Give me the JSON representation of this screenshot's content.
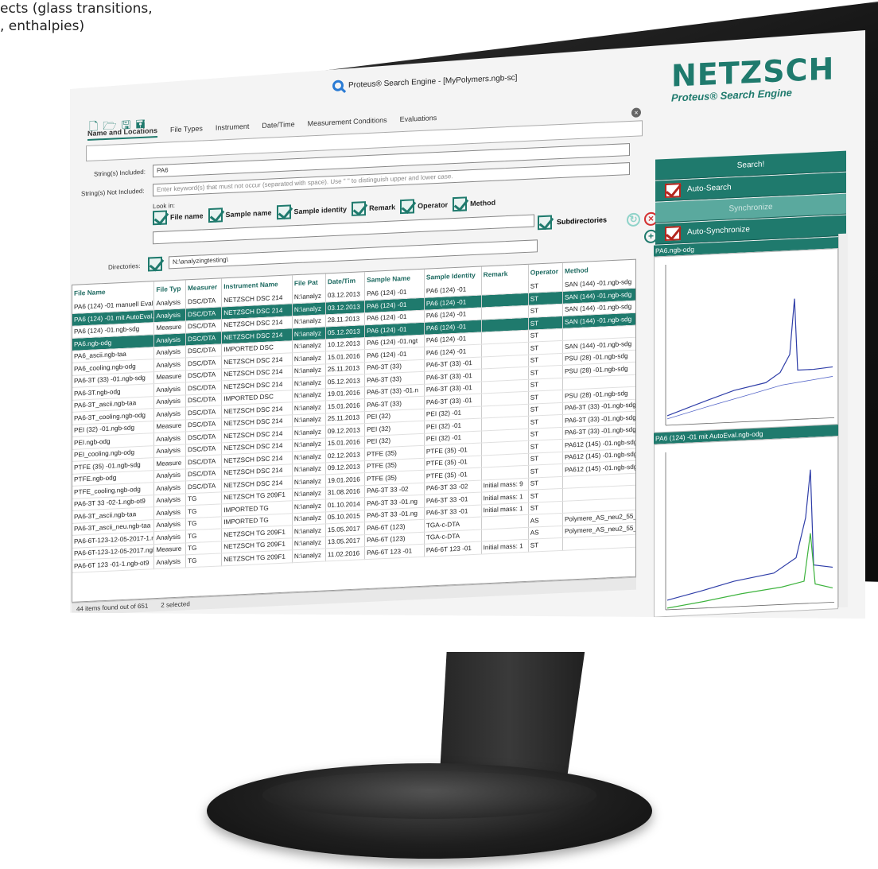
{
  "caption": {
    "line1": "ects (glass transitions,",
    "line2": ", enthalpies)"
  },
  "window": {
    "title": "Proteus® Search Engine - [MyPolymers.ngb-sc]",
    "minimize": "–",
    "maximize": "□",
    "close": "✕"
  },
  "tabs": [
    "Name and Locations",
    "File Types",
    "Instrument",
    "Date/Time",
    "Measurement Conditions",
    "Evaluations"
  ],
  "form": {
    "included_label": "String(s) Included:",
    "included_value": "PA6",
    "not_included_label": "String(s) Not Included:",
    "not_included_placeholder": "Enter keyword(s) that must not occur (separated with space). Use \" \" to distinguish upper and lower case.",
    "look_in_label": "Look in:",
    "look_in": [
      "File name",
      "Sample name",
      "Sample identity",
      "Remark",
      "Operator",
      "Method"
    ],
    "subdirectories_label": "Subdirectories",
    "directories_label": "Directories:",
    "directories_value": "N:\\analyzingtesting\\"
  },
  "table": {
    "columns": [
      "File Name",
      "File Typ",
      "Measurer",
      "Instrument Name",
      "File Pat",
      "Date/Tim",
      "Sample Name",
      "Sample Identity",
      "Remark",
      "Operator",
      "Method"
    ],
    "rows": [
      {
        "cells": [
          "PA6 (124) -01 manuell Eval.n",
          "Analysis",
          "DSC/DTA",
          "NETZSCH DSC 214",
          "N:\\analyz",
          "03.12.2013",
          "PA6 (124) -01",
          "PA6 (124) -01",
          "",
          "ST",
          "SAN (144) -01.ngb-sdg"
        ],
        "state": ""
      },
      {
        "cells": [
          "PA6 (124) -01 mit AutoEval.n",
          "Analysis",
          "DSC/DTA",
          "NETZSCH DSC 214",
          "N:\\analyz",
          "03.12.2013",
          "PA6 (124) -01",
          "PA6 (124) -01",
          "",
          "ST",
          "SAN (144) -01.ngb-sdg"
        ],
        "state": "sel"
      },
      {
        "cells": [
          "PA6 (124) -01.ngb-sdg",
          "Measure",
          "DSC/DTA",
          "NETZSCH DSC 214",
          "N:\\analyz",
          "28.11.2013",
          "PA6 (124) -01",
          "PA6 (124) -01",
          "",
          "ST",
          "SAN (144) -01.ngb-sdg"
        ],
        "state": ""
      },
      {
        "cells": [
          "PA6.ngb-odg",
          "Analysis",
          "DSC/DTA",
          "NETZSCH DSC 214",
          "N:\\analyz",
          "05.12.2013",
          "PA6 (124) -01",
          "PA6 (124) -01",
          "",
          "ST",
          "SAN (144) -01.ngb-sdg"
        ],
        "state": "sel"
      },
      {
        "cells": [
          "PA6_ascii.ngb-taa",
          "Analysis",
          "DSC/DTA",
          "IMPORTED DSC",
          "N:\\analyz",
          "10.12.2013",
          "PA6 (124) -01.ngt",
          "PA6 (124) -01",
          "",
          "ST",
          ""
        ],
        "state": ""
      },
      {
        "cells": [
          "PA6_cooling.ngb-odg",
          "Analysis",
          "DSC/DTA",
          "NETZSCH DSC 214",
          "N:\\analyz",
          "15.01.2016",
          "PA6 (124) -01",
          "PA6 (124) -01",
          "",
          "ST",
          "SAN (144) -01.ngb-sdg"
        ],
        "state": ""
      },
      {
        "cells": [
          "PA6-3T (33) -01.ngb-sdg",
          "Measure",
          "DSC/DTA",
          "NETZSCH DSC 214",
          "N:\\analyz",
          "25.11.2013",
          "PA6-3T (33)",
          "PA6-3T (33) -01",
          "",
          "ST",
          "PSU (28) -01.ngb-sdg"
        ],
        "state": ""
      },
      {
        "cells": [
          "PA6-3T.ngb-odg",
          "Analysis",
          "DSC/DTA",
          "NETZSCH DSC 214",
          "N:\\analyz",
          "05.12.2013",
          "PA6-3T (33)",
          "PA6-3T (33) -01",
          "",
          "ST",
          "PSU (28) -01.ngb-sdg"
        ],
        "state": ""
      },
      {
        "cells": [
          "PA6-3T_ascii.ngb-taa",
          "Analysis",
          "DSC/DTA",
          "IMPORTED DSC",
          "N:\\analyz",
          "19.01.2016",
          "PA6-3T (33) -01.n",
          "PA6-3T (33) -01",
          "",
          "ST",
          ""
        ],
        "state": ""
      },
      {
        "cells": [
          "PA6-3T_cooling.ngb-odg",
          "Analysis",
          "DSC/DTA",
          "NETZSCH DSC 214",
          "N:\\analyz",
          "15.01.2016",
          "PA6-3T (33)",
          "PA6-3T (33) -01",
          "",
          "ST",
          "PSU (28) -01.ngb-sdg"
        ],
        "state": ""
      },
      {
        "cells": [
          "PEI (32) -01.ngb-sdg",
          "Measure",
          "DSC/DTA",
          "NETZSCH DSC 214",
          "N:\\analyz",
          "25.11.2013",
          "PEI (32)",
          "PEI (32) -01",
          "",
          "ST",
          "PA6-3T (33) -01.ngb-sdg"
        ],
        "state": ""
      },
      {
        "cells": [
          "PEI.ngb-odg",
          "Analysis",
          "DSC/DTA",
          "NETZSCH DSC 214",
          "N:\\analyz",
          "09.12.2013",
          "PEI (32)",
          "PEI (32) -01",
          "",
          "ST",
          "PA6-3T (33) -01.ngb-sdg"
        ],
        "state": ""
      },
      {
        "cells": [
          "PEI_cooling.ngb-odg",
          "Analysis",
          "DSC/DTA",
          "NETZSCH DSC 214",
          "N:\\analyz",
          "15.01.2016",
          "PEI (32)",
          "PEI (32) -01",
          "",
          "ST",
          "PA6-3T (33) -01.ngb-sdg"
        ],
        "state": ""
      },
      {
        "cells": [
          "PTFE (35) -01.ngb-sdg",
          "Measure",
          "DSC/DTA",
          "NETZSCH DSC 214",
          "N:\\analyz",
          "02.12.2013",
          "PTFE (35)",
          "PTFE (35) -01",
          "",
          "ST",
          "PA612 (145) -01.ngb-sdg"
        ],
        "state": ""
      },
      {
        "cells": [
          "PTFE.ngb-odg",
          "Analysis",
          "DSC/DTA",
          "NETZSCH DSC 214",
          "N:\\analyz",
          "09.12.2013",
          "PTFE (35)",
          "PTFE (35) -01",
          "",
          "ST",
          "PA612 (145) -01.ngb-sdg"
        ],
        "state": ""
      },
      {
        "cells": [
          "PTFE_cooling.ngb-odg",
          "Analysis",
          "DSC/DTA",
          "NETZSCH DSC 214",
          "N:\\analyz",
          "19.01.2016",
          "PTFE (35)",
          "PTFE (35) -01",
          "",
          "ST",
          "PA612 (145) -01.ngb-sdg"
        ],
        "state": ""
      },
      {
        "cells": [
          "PA6-3T 33 -02-1.ngb-ot9",
          "Analysis",
          "TG",
          "NETZSCH TG 209F1",
          "N:\\analyz",
          "31.08.2016",
          "PA6-3T 33 -02",
          "PA6-3T 33 -02",
          "Initial mass: 9",
          "ST",
          ""
        ],
        "state": ""
      },
      {
        "cells": [
          "PA6-3T_ascii.ngb-taa",
          "Analysis",
          "TG",
          "IMPORTED TG",
          "N:\\analyz",
          "01.10.2014",
          "PA6-3T 33 -01.ng",
          "PA6-3T 33 -01",
          "Initial mass: 1",
          "ST",
          ""
        ],
        "state": ""
      },
      {
        "cells": [
          "PA6-3T_ascii_neu.ngb-taa",
          "Analysis",
          "TG",
          "IMPORTED TG",
          "N:\\analyz",
          "05.10.2015",
          "PA6-3T 33 -01.ng",
          "PA6-3T 33 -01",
          "Initial mass: 1",
          "ST",
          ""
        ],
        "state": ""
      },
      {
        "cells": [
          "PA6-6T-123-12-05-2017-1.nc",
          "Analysis",
          "TG",
          "NETZSCH TG 209F1",
          "N:\\analyz",
          "15.05.2017",
          "PA6-6T (123)",
          "TGA-c-DTA",
          "",
          "AS",
          "Polymere_AS_neu2_55_TGA"
        ],
        "state": ""
      },
      {
        "cells": [
          "PA6-6T-123-12-05-2017.ngb",
          "Measure",
          "TG",
          "NETZSCH TG 209F1",
          "N:\\analyz",
          "13.05.2017",
          "PA6-6T (123)",
          "TGA-c-DTA",
          "",
          "AS",
          "Polymere_AS_neu2_55_TGA"
        ],
        "state": ""
      },
      {
        "cells": [
          "PA6-6T 123 -01-1.ngb-ot9",
          "Analysis",
          "TG",
          "NETZSCH TG 209F1",
          "N:\\analyz",
          "11.02.2016",
          "PA6-6T 123 -01",
          "PA6-6T 123 -01",
          "Initial mass: 1",
          "ST",
          ""
        ],
        "state": ""
      }
    ]
  },
  "status": {
    "found": "44 items found out of 651",
    "selected": "2 selected"
  },
  "brand": {
    "logo": "NETZSCH",
    "product": "Proteus® Search Engine"
  },
  "side": {
    "search": "Search!",
    "auto_search": "Auto-Search",
    "synchronize": "Synchronize",
    "auto_synchronize": "Auto-Synchronize",
    "preview1_title": "PA6.ngb-odg",
    "preview2_title": "PA6 (124) -01 mit AutoEval.ngb-odg"
  },
  "colors": {
    "accent": "#1f7a6d",
    "selection": "#1f7a6d",
    "error": "#b3261e"
  }
}
